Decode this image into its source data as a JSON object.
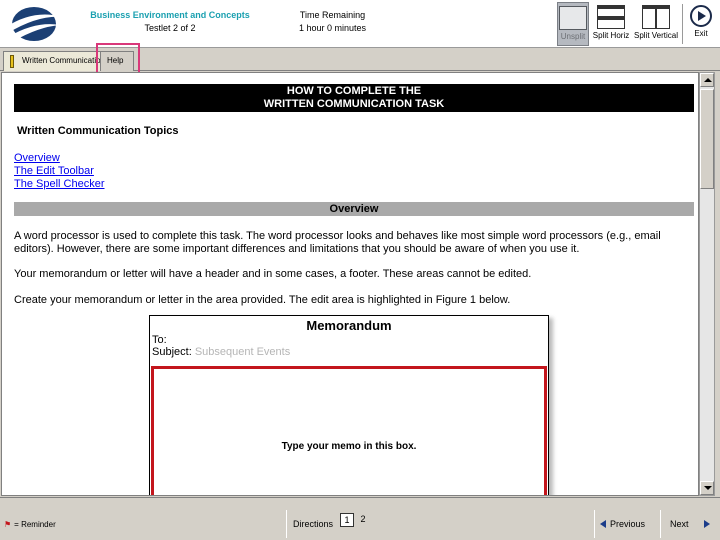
{
  "header": {
    "exam_title": "Business Environment and Concepts",
    "testlet": "Testlet 2 of 2",
    "time_label": "Time Remaining",
    "time_value": "1 hour 0 minutes",
    "logo_icon": "globe-logo-icon"
  },
  "toolbar": {
    "unsplit_label": "Unsplit",
    "split_horiz_label": "Split Horiz",
    "split_vertical_label": "Split Vertical",
    "exit_label": "Exit",
    "unsplit_icon": "unsplit-icon",
    "split_horiz_icon": "split-horizontal-icon",
    "split_vertical_icon": "split-vertical-icon",
    "exit_icon": "exit-arrow-icon"
  },
  "tabs": [
    {
      "label": "Written Communication",
      "icon": "pencil-icon"
    },
    {
      "label": "Help"
    }
  ],
  "content": {
    "title_line1": "HOW TO COMPLETE THE",
    "title_line2": "WRITTEN COMMUNICATION TASK",
    "topics_heading": "Written Communication Topics",
    "links": [
      "Overview",
      "The Edit Toolbar",
      "The Spell Checker"
    ],
    "section_title": "Overview",
    "para1": "A word processor is used to complete this task.  The word processor looks and behaves like most simple word processors (e.g., email editors).  However, there are some important differences and limitations that you should be aware of when you use it.",
    "para2": "Your memorandum or letter will have a header and in some cases, a footer.  These areas cannot be edited.",
    "para3": "Create your memorandum or letter in the area provided.  The edit area is highlighted in Figure 1 below."
  },
  "figure": {
    "memo_title": "Memorandum",
    "to_label": "To:",
    "subject_label": "Subject:",
    "subject_value": "Subsequent Events",
    "edit_box_text": "Type your memo in this box."
  },
  "bottom": {
    "reminder_label": "= Reminder",
    "reminder_icon": "flag-icon",
    "directions_label": "Directions",
    "pages": [
      "1",
      "2"
    ],
    "previous_label": "Previous",
    "next_label": "Next"
  },
  "colors": {
    "accent_title": "#1ba0b0",
    "highlight_box": "#d9387a",
    "edit_box_border": "#c3151c",
    "link": "#0000ee"
  }
}
